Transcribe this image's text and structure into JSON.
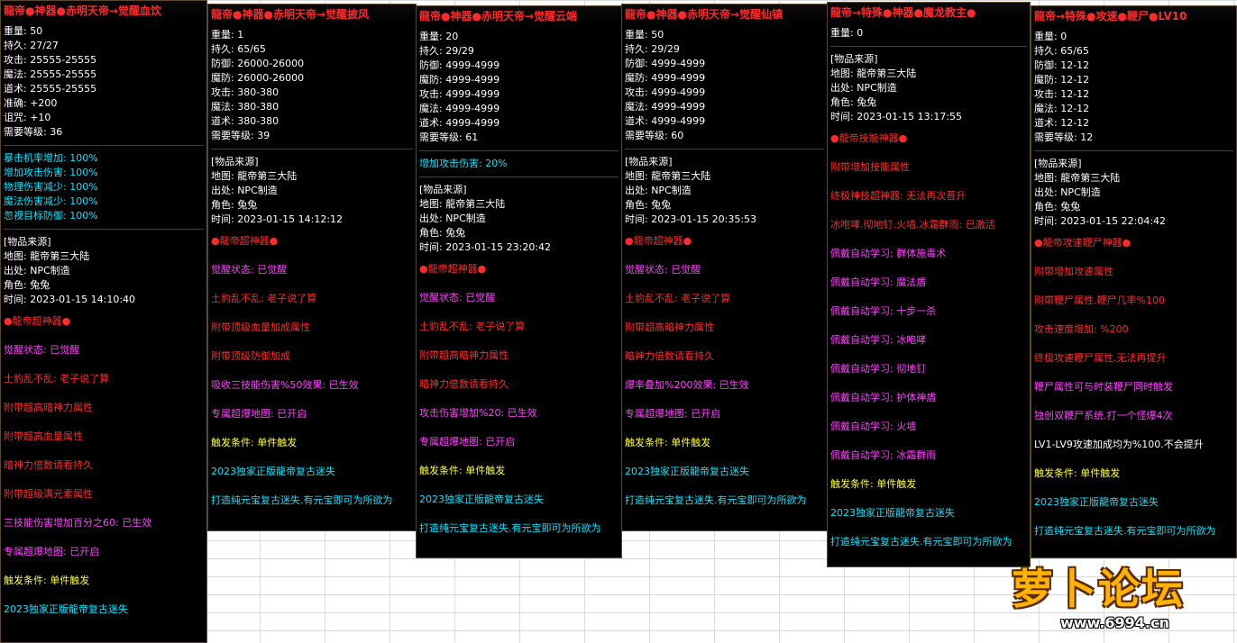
{
  "panels": [
    {
      "title": "龍帝●神器●赤明天帝→觉醒血饮",
      "stats": [
        "重量: 50",
        "持久: 27/27",
        "攻击: 25555-25555",
        "魔法: 25555-25555",
        "道术: 25555-25555",
        "准确: +200",
        "诅咒: +10",
        "需要等级: 36"
      ],
      "extras": [
        "暴击机率增加: 100%",
        "增加攻击伤害: 100%",
        "物理伤害减少: 100%",
        "魔法伤害减少: 100%",
        "忽视目标防御: 100%"
      ],
      "source": [
        "[物品来源]",
        "地图: 龍帝第三大陆",
        "出处: NPC制造",
        "角色: 兔兔",
        "时间: 2023-01-15 14:10:40"
      ],
      "specials": [
        {
          "t": "●龍帝超神器●",
          "c": "red"
        },
        {
          "t": "觉醒状态: 已觉醒",
          "c": "mag"
        },
        {
          "t": "土豹乱不乱: 老子说了算",
          "c": "red"
        },
        {
          "t": "附带超高暗神力属性",
          "c": "red"
        },
        {
          "t": "附带超高血量属性",
          "c": "red"
        },
        {
          "t": "暗神力倍数请看持久",
          "c": "red"
        },
        {
          "t": "附带超级满元素属性",
          "c": "red"
        },
        {
          "t": "三技能伤害增加百分之60: 已生效",
          "c": "mag"
        },
        {
          "t": "专属超爆地图: 已开启",
          "c": "mag"
        },
        {
          "t": "触发条件: 单件触发",
          "c": "yel"
        },
        {
          "t": "2023独家正版龍帝复古迷失",
          "c": "cyan"
        }
      ]
    },
    {
      "title": "龍帝●神器●赤明天帝→觉醒披风",
      "stats": [
        "重量: 1",
        "持久: 65/65",
        "防御: 26000-26000",
        "魔防: 26000-26000",
        "攻击: 380-380",
        "魔法: 380-380",
        "道术: 380-380",
        "需要等级: 39"
      ],
      "extras": [],
      "source": [
        "[物品来源]",
        "地图: 龍帝第三大陆",
        "出处: NPC制造",
        "角色: 兔兔",
        "时间: 2023-01-15 14:12:12"
      ],
      "specials": [
        {
          "t": "●龍帝超神器●",
          "c": "red"
        },
        {
          "t": "觉醒状态: 已觉醒",
          "c": "mag"
        },
        {
          "t": "土豹乱不乱: 老子说了算",
          "c": "red"
        },
        {
          "t": "附带顶级血量加成属性",
          "c": "red"
        },
        {
          "t": "附带顶级防御加成",
          "c": "red"
        },
        {
          "t": "吸收三技能伤害%50效果: 已生效",
          "c": "mag"
        },
        {
          "t": "专属超爆地图: 已开启",
          "c": "mag"
        },
        {
          "t": "触发条件: 单件触发",
          "c": "yel"
        },
        {
          "t": "2023独家正版龍帝复古迷失",
          "c": "cyan"
        },
        {
          "t": "打造纯元宝复古迷失.有元宝即可为所欲为",
          "c": "cyan"
        }
      ]
    },
    {
      "title": "龍帝●神器●赤明天帝→觉醒云端",
      "stats": [
        "重量: 20",
        "持久: 29/29",
        "防御: 4999-4999",
        "魔防: 4999-4999",
        "攻击: 4999-4999",
        "魔法: 4999-4999",
        "道术: 4999-4999",
        "需要等级: 61"
      ],
      "extras": [
        "增加攻击伤害: 20%"
      ],
      "source": [
        "[物品来源]",
        "地图: 龍帝第三大陆",
        "出处: NPC制造",
        "角色: 兔兔",
        "时间: 2023-01-15 23:20:42"
      ],
      "specials": [
        {
          "t": "●龍帝超神器●",
          "c": "red"
        },
        {
          "t": "觉醒状态: 已觉醒",
          "c": "mag"
        },
        {
          "t": "土豹乱不乱: 老子说了算",
          "c": "red"
        },
        {
          "t": "附带超高暗神力属性",
          "c": "red"
        },
        {
          "t": "暗神力倍数请看持久",
          "c": "red"
        },
        {
          "t": "攻击伤害增加%20: 已生效",
          "c": "mag"
        },
        {
          "t": "专属超爆地图: 已开启",
          "c": "mag"
        },
        {
          "t": "触发条件: 单件触发",
          "c": "yel"
        },
        {
          "t": "2023独家正版龍帝复古迷失",
          "c": "cyan"
        },
        {
          "t": "打造纯元宝复古迷失.有元宝即可为所欲为",
          "c": "cyan"
        }
      ]
    },
    {
      "title": "龍帝●神器●赤明天帝→觉醒仙镇",
      "stats": [
        "重量: 50",
        "持久: 29/29",
        "防御: 4999-4999",
        "魔防: 4999-4999",
        "攻击: 4999-4999",
        "魔法: 4999-4999",
        "道术: 4999-4999",
        "需要等级: 60"
      ],
      "extras": [],
      "source": [
        "[物品来源]",
        "地图: 龍帝第三大陆",
        "出处: NPC制造",
        "角色: 兔兔",
        "时间: 2023-01-15 20:35:53"
      ],
      "specials": [
        {
          "t": "●龍帝超神器●",
          "c": "red"
        },
        {
          "t": "觉醒状态: 已觉醒",
          "c": "mag"
        },
        {
          "t": "土豹乱不乱: 老子说了算",
          "c": "red"
        },
        {
          "t": "附带超高暗神力属性",
          "c": "red"
        },
        {
          "t": "暗神力倍数请看持久",
          "c": "red"
        },
        {
          "t": "爆率叠加%200效果: 已生效",
          "c": "mag"
        },
        {
          "t": "专属超爆地图: 已开启",
          "c": "mag"
        },
        {
          "t": "触发条件: 单件触发",
          "c": "yel"
        },
        {
          "t": "2023独家正版龍帝复古迷失",
          "c": "cyan"
        },
        {
          "t": "打造纯元宝复古迷失.有元宝即可为所欲为",
          "c": "cyan"
        }
      ]
    },
    {
      "title": "龍帝→特殊●神器●魔龙教主●",
      "stats": [
        "重量: 0"
      ],
      "extras": [],
      "source": [
        "[物品来源]",
        "地图: 龍帝第三大陆",
        "出处: NPC制造",
        "角色: 兔兔",
        "时间: 2023-01-15 13:17:55"
      ],
      "specials": [
        {
          "t": "●龍帝技能神器●",
          "c": "red"
        },
        {
          "t": "附带增加技能属性",
          "c": "red"
        },
        {
          "t": "终极神技超神器: 无法再次晋升",
          "c": "red"
        },
        {
          "t": "冰咆哮.彻地钉.火墙.冰霜群雨: 已激活",
          "c": "red"
        },
        {
          "t": "佩戴自动学习: 群体施毒术",
          "c": "mag"
        },
        {
          "t": "佩戴自动学习: 魔法盾",
          "c": "mag"
        },
        {
          "t": "佩戴自动学习: 十步一杀",
          "c": "mag"
        },
        {
          "t": "佩戴自动学习: 冰咆哮",
          "c": "mag"
        },
        {
          "t": "佩戴自动学习: 彻地钉",
          "c": "mag"
        },
        {
          "t": "佩戴自动学习: 护体神盾",
          "c": "mag"
        },
        {
          "t": "佩戴自动学习: 火墙",
          "c": "mag"
        },
        {
          "t": "佩戴自动学习: 冰霜群雨",
          "c": "mag"
        },
        {
          "t": "触发条件: 单件触发",
          "c": "yel"
        },
        {
          "t": "2023独家正版龍帝复古迷失",
          "c": "cyan"
        },
        {
          "t": "打造纯元宝复古迷失.有元宝即可为所欲为",
          "c": "cyan"
        }
      ]
    },
    {
      "title": "龍帝→特殊●攻速●鞭尸●LV10",
      "stats": [
        "重量: 0",
        "持久: 65/65",
        "防御: 12-12",
        "魔防: 12-12",
        "攻击: 12-12",
        "魔法: 12-12",
        "道术: 12-12",
        "需要等级: 12"
      ],
      "extras": [],
      "source": [
        "[物品来源]",
        "地图: 龍帝第三大陆",
        "出处: NPC制造",
        "角色: 兔兔",
        "时间: 2023-01-15 22:04:42"
      ],
      "specials": [
        {
          "t": "●龍帝攻速鞭尸神器●",
          "c": "red"
        },
        {
          "t": "附带增加攻速属性",
          "c": "red"
        },
        {
          "t": "附带鞭尸属性.鞭尸几率%100",
          "c": "red"
        },
        {
          "t": "攻击速度增加: %200",
          "c": "red"
        },
        {
          "t": "终极攻速鞭尸属性.无法再提升",
          "c": "red"
        },
        {
          "t": "鞭尸属性可与时装鞭尸同时触发",
          "c": "mag"
        },
        {
          "t": "独创双鞭尸系统.打一个怪爆4次",
          "c": "mag"
        },
        {
          "t": "LV1-LV9攻速加成均为%100.不会提升",
          "c": "w"
        },
        {
          "t": "触发条件: 单件触发",
          "c": "yel"
        },
        {
          "t": "2023独家正版龍帝复古迷失",
          "c": "cyan"
        },
        {
          "t": "打造纯元宝复古迷失.有元宝即可为所欲为",
          "c": "cyan"
        }
      ]
    }
  ],
  "watermark": {
    "brand": "萝卜论坛",
    "url": "www.6994.cn"
  }
}
